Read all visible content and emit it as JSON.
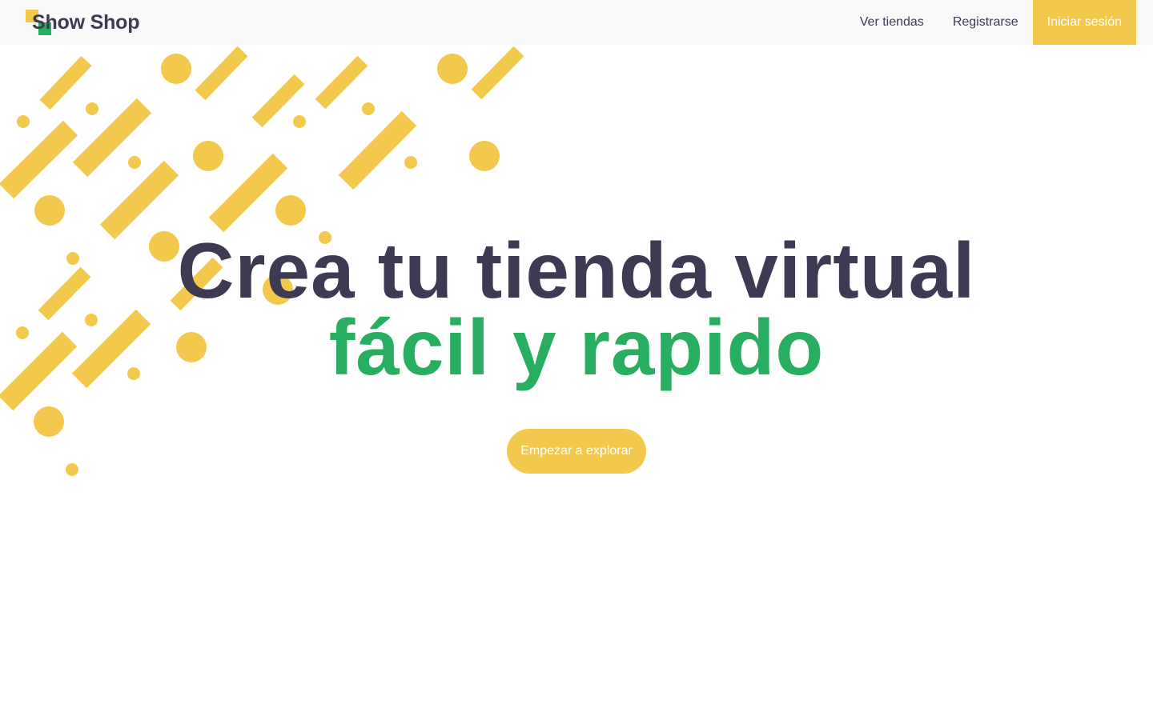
{
  "brand": {
    "name": "Show Shop",
    "colors": {
      "primary_dark": "#3d3b54",
      "accent_green": "#27ae60",
      "accent_yellow": "#f2c94c",
      "header_bg": "#f9f9f9"
    },
    "logo_icon": "two-squares-logo-icon"
  },
  "nav": {
    "links": [
      {
        "label": "Ver tiendas"
      },
      {
        "label": "Registrarse"
      }
    ],
    "cta_label": "Iniciar sesión"
  },
  "hero": {
    "title_line1": "Crea tu tienda virtual",
    "title_line2": "fácil y rapido",
    "button_label": "Empezar a explorar"
  },
  "decoration": {
    "icon": "yellow-confetti-pattern-icon"
  }
}
